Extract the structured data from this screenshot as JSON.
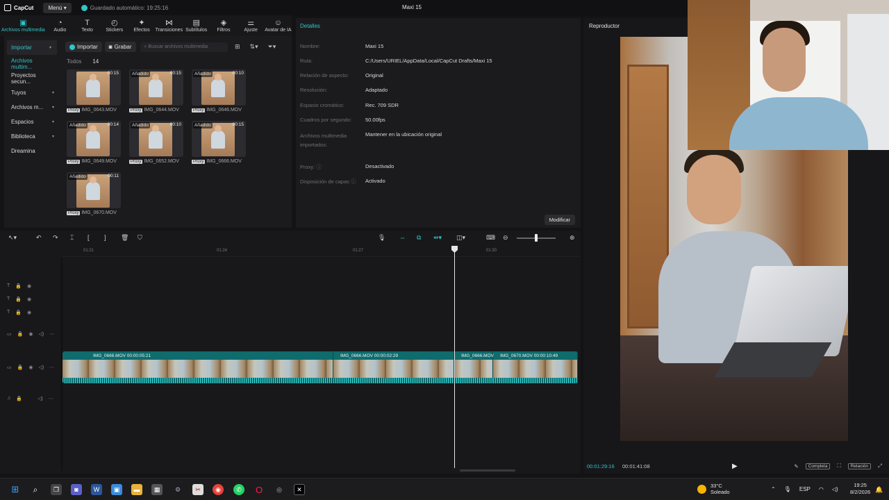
{
  "app": {
    "logo": "CapCut",
    "menu": "Menú",
    "autosave": "Guardado automático: 19:25:16",
    "project_title": "Maxi 15"
  },
  "toolbar": [
    {
      "label": "Archivos multimedia",
      "icon": "media-icon",
      "glyph": "▣"
    },
    {
      "label": "Audio",
      "icon": "audio-icon",
      "glyph": "◔"
    },
    {
      "label": "Texto",
      "icon": "text-icon",
      "glyph": "T"
    },
    {
      "label": "Stickers",
      "icon": "sticker-icon",
      "glyph": "◴"
    },
    {
      "label": "Efectos",
      "icon": "effects-icon",
      "glyph": "✦"
    },
    {
      "label": "Transiciones",
      "icon": "transition-icon",
      "glyph": "⋈"
    },
    {
      "label": "Subtítulos",
      "icon": "caption-icon",
      "glyph": "▤"
    },
    {
      "label": "Filtros",
      "icon": "filter-icon",
      "glyph": "◈"
    },
    {
      "label": "Ajuste",
      "icon": "adjust-icon",
      "glyph": "⚌"
    },
    {
      "label": "Avatar de IA",
      "icon": "avatar-icon",
      "glyph": "☺"
    }
  ],
  "side_nav": [
    {
      "label": "Importar",
      "chev": "▾"
    },
    {
      "label": "Archivos multim...",
      "chev": ""
    },
    {
      "label": "Proyectos secun...",
      "chev": ""
    },
    {
      "label": "Tuyos",
      "chev": "▾"
    },
    {
      "label": "Archivos m...",
      "chev": "▾"
    },
    {
      "label": "Espacios",
      "chev": "▾"
    },
    {
      "label": "Biblioteca",
      "chev": "▾"
    },
    {
      "label": "Dreamina",
      "chev": ""
    }
  ],
  "media": {
    "import_label": "Importar",
    "record_label": "Grabar",
    "search_placeholder": "Buscar archivos multimedia",
    "all_label": "Todos",
    "count": "14",
    "items": [
      {
        "tag": "",
        "duration": "00:15",
        "proxy": "Proxy",
        "name": "IMG_0643.MOV"
      },
      {
        "tag": "Añadido",
        "duration": "00:15",
        "proxy": "Proxy",
        "name": "IMG_0644.MOV"
      },
      {
        "tag": "Añadido",
        "duration": "00:10",
        "proxy": "Proxy",
        "name": "IMG_0646.MOV"
      },
      {
        "tag": "Añadido",
        "duration": "00:14",
        "proxy": "Proxy",
        "name": "IMG_0649.MOV"
      },
      {
        "tag": "Añadido",
        "duration": "00:10",
        "proxy": "Proxy",
        "name": "IMG_0652.MOV"
      },
      {
        "tag": "Añadido",
        "duration": "00:15",
        "proxy": "Proxy",
        "name": "IMG_0666.MOV"
      },
      {
        "tag": "Añadido",
        "duration": "00:11",
        "proxy": "Proxy",
        "name": "IMG_0670.MOV"
      }
    ]
  },
  "details": {
    "title": "Detalles",
    "rows": [
      {
        "k": "Nombre:",
        "v": "Maxi 15"
      },
      {
        "k": "Ruta:",
        "v": "C:/Users/URIEL/AppData/Local/CapCut Drafts/Maxi 15"
      },
      {
        "k": "Relación de aspecto:",
        "v": "Original"
      },
      {
        "k": "Resolución:",
        "v": "Adaptado"
      },
      {
        "k": "Espacio cromático:",
        "v": "Rec. 709 SDR"
      },
      {
        "k": "Cuadros por segundo:",
        "v": "50.00fps"
      },
      {
        "k": "Archivos multimedia importados:",
        "v": "Mantener en la ubicación original"
      },
      {
        "k": "Proxy: ⓘ",
        "v": "Desactivado"
      },
      {
        "k": "Disposición de capas ⓘ",
        "v": "Activado"
      }
    ],
    "modify_label": "Modificar"
  },
  "player": {
    "title": "Reproductor",
    "current_time": "00:01:29:16",
    "total_time": "00:01:41:08",
    "full_label": "Completa",
    "ratio_label": "Relación"
  },
  "timeline": {
    "ruler": [
      "01:21",
      "01:24",
      "01:27",
      "01:30"
    ],
    "clips": [
      {
        "label": "IMG_0666.MOV  00:00:05:21"
      },
      {
        "label": "IMG_0666.MOV  00:00:02:29"
      },
      {
        "label": "IMG_0666.MOV"
      },
      {
        "label": "IMG_0670.MOV  00:00:10:49"
      }
    ]
  },
  "taskbar": {
    "weather_temp": "33°C",
    "weather_desc": "Soleado",
    "lang": "ESP",
    "time": "19:25",
    "date": "8/2/2026"
  },
  "colors": {
    "accent": "#2fc7c7",
    "track": "#0f6b6c",
    "panel": "#1b1b1e"
  }
}
